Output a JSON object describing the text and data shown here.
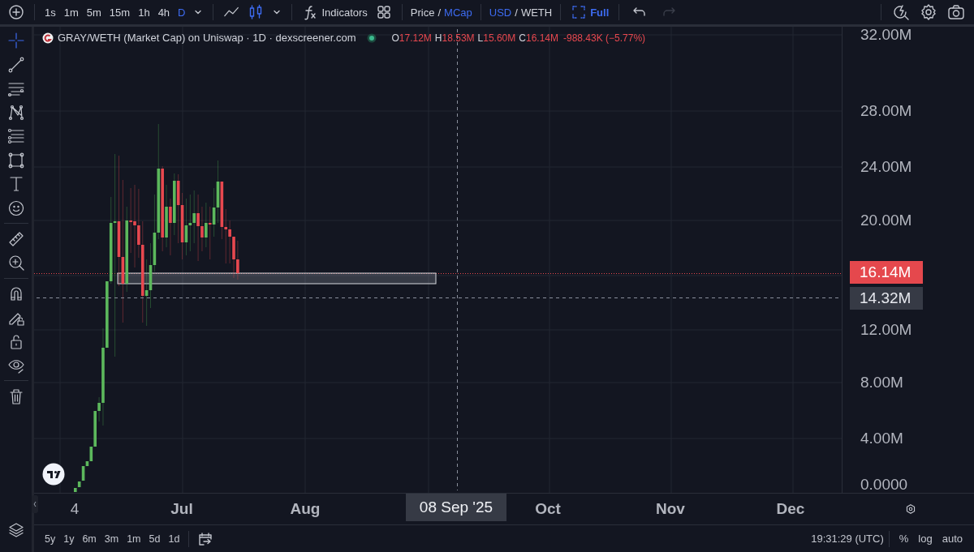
{
  "toolbar": {
    "intervals": [
      {
        "label": "1s",
        "selected": false
      },
      {
        "label": "1m",
        "selected": false
      },
      {
        "label": "5m",
        "selected": false
      },
      {
        "label": "15m",
        "selected": false
      },
      {
        "label": "1h",
        "selected": false
      },
      {
        "label": "4h",
        "selected": false
      },
      {
        "label": "D",
        "selected": true
      }
    ],
    "chart_types": [
      {
        "kind": "line",
        "selected": false
      },
      {
        "kind": "candles",
        "selected": true
      }
    ],
    "indicators_label": "Indicators",
    "price_mode": {
      "separator": "/",
      "options": [
        {
          "label": "Price",
          "selected": false
        },
        {
          "label": "MCap",
          "selected": true
        }
      ]
    },
    "currency": {
      "separator": "/",
      "options": [
        {
          "label": "USD",
          "selected": true
        },
        {
          "label": "WETH",
          "selected": false
        }
      ]
    },
    "full_label": "Full",
    "history": [
      {
        "kind": "undo",
        "disabled": false
      },
      {
        "kind": "redo",
        "disabled": true
      }
    ]
  },
  "tool_groups": [
    [
      {
        "kind": "crosshair",
        "selected": true
      },
      {
        "kind": "trend-line",
        "selected": false
      },
      {
        "kind": "horizontal-lines",
        "selected": false
      },
      {
        "kind": "pattern",
        "selected": false
      },
      {
        "kind": "fib",
        "selected": false
      },
      {
        "kind": "rectangle",
        "selected": false
      },
      {
        "kind": "text",
        "selected": false
      },
      {
        "kind": "emoji",
        "selected": false
      }
    ],
    [
      {
        "kind": "ruler",
        "selected": false
      },
      {
        "kind": "zoom-in",
        "selected": false
      }
    ],
    [
      {
        "kind": "magnet",
        "selected": false
      },
      {
        "kind": "lock-draw",
        "selected": false
      },
      {
        "kind": "lock",
        "selected": false
      },
      {
        "kind": "eye",
        "selected": false
      }
    ],
    [
      {
        "kind": "trash",
        "selected": false
      }
    ]
  ],
  "legend": {
    "title": "GRAY/WETH (Market Cap) on Uniswap · 1D · dexscreener.com",
    "ohlc": [
      {
        "label": "O",
        "value": "17.12M"
      },
      {
        "label": "H",
        "value": "18.53M"
      },
      {
        "label": "L",
        "value": "15.60M"
      },
      {
        "label": "C",
        "value": "16.14M"
      }
    ],
    "change": "-988.43K (−5.77%)"
  },
  "price_axis": {
    "ticks": [
      "32.00M",
      "28.00M",
      "24.00M",
      "20.00M",
      "12.00M",
      "8.00M",
      "4.00M",
      "0.0000"
    ],
    "last_price": "16.14M",
    "crosshair_price": "14.32M"
  },
  "time_axis": {
    "ticks": [
      "4",
      "Jul",
      "Aug",
      "Oct",
      "Nov",
      "Dec"
    ],
    "crosshair_date": "08 Sep '25"
  },
  "ranges": [
    "5y",
    "1y",
    "6m",
    "3m",
    "1m",
    "5d",
    "1d"
  ],
  "status": {
    "time": "19:31:29 (UTC)",
    "options": [
      "%",
      "log",
      "auto"
    ]
  }
}
